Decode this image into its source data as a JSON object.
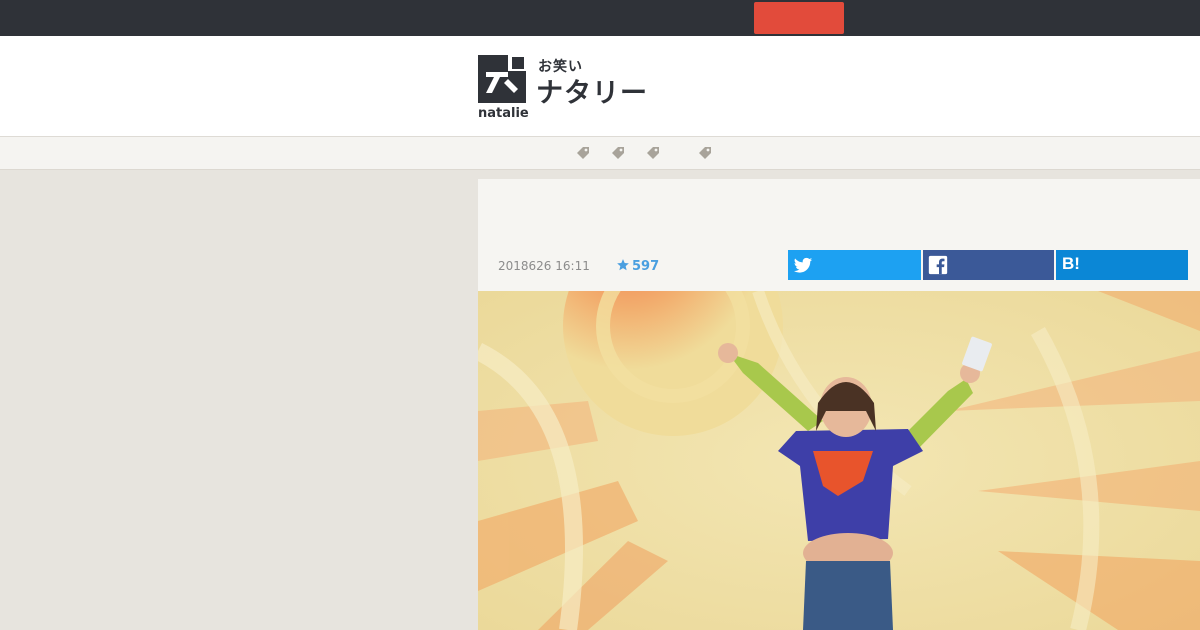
{
  "logo": {
    "small_text": "お笑い",
    "big_text": "ナタリー",
    "wordmark": "natalie",
    "mark_icon": "natalie-logo-mark"
  },
  "nav": {
    "tag_icon": "tag-icon",
    "tag_count": 4
  },
  "article": {
    "date": "2018626 16:11",
    "favorites": "597",
    "favorite_icon": "star-icon"
  },
  "share": {
    "twitter_icon": "twitter-icon",
    "facebook_icon": "facebook-icon",
    "hatena_label": "B!"
  },
  "colors": {
    "topbar": "#2f3238",
    "topbar_button": "#e24b3b",
    "twitter": "#1da1f2",
    "facebook": "#3b5998",
    "hatena": "#0b87d6",
    "favorites": "#4a9fe0"
  }
}
